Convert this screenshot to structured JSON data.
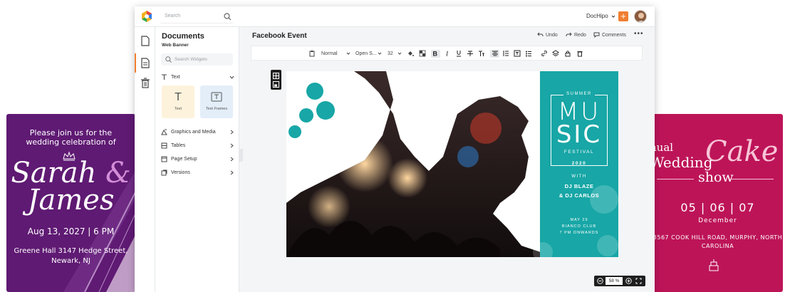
{
  "left_card": {
    "invite": "Please join us for the wedding celebration of",
    "name_one": "Sarah",
    "amp": "&",
    "name_two": "James",
    "date": "Aug 13, 2027 | 6 PM",
    "address": "Greene Hall 3147 Hedge Street, Newark, NJ",
    "color": "#5f1a73"
  },
  "right_card": {
    "annual": "nual",
    "wedding": "Wedding",
    "cake": "Cake",
    "show": "show",
    "date_numbers": "05 | 06 | 07",
    "month": "December",
    "address": "3567 COOK HILL ROAD, MURPHY, NORTH CAROLINA",
    "color": "#bd1458"
  },
  "topbar": {
    "search_placeholder": "Search",
    "account": "DocHipo",
    "plus": "+"
  },
  "panel": {
    "title": "Documents",
    "subtitle": "Web Banner",
    "widget_search_placeholder": "Search Widgets",
    "text_section": "Text",
    "tiles": [
      {
        "glyph": "T",
        "caption": "Text",
        "color": "#fdf3dc"
      },
      {
        "glyph": "⊤",
        "caption": "Text Frames",
        "color": "#e3eef9"
      }
    ],
    "sections": [
      "Graphics and Media",
      "Tables",
      "Page Setup",
      "Versions"
    ]
  },
  "editor": {
    "doc_title": "Facebook Event",
    "undo": "Undo",
    "redo": "Redo",
    "comments": "Comments",
    "more": "•••"
  },
  "toolbar": {
    "style": "Normal",
    "font": "Open S...",
    "size": "32"
  },
  "design": {
    "summer": "SUMMER",
    "mu": "MU",
    "sic": "SIC",
    "festival": "FESTIVAL",
    "year": "2020",
    "with": "WITH",
    "dj_one": "DJ BLAZE",
    "dj_two": "& DJ CARLOS",
    "date": "MAY 29",
    "venue": "BIANCO CLUB",
    "time": "7 PM ONWARDS",
    "accent": "#18a6a6"
  },
  "zoom": {
    "value": "58",
    "unit": "%"
  },
  "colors": {
    "brand_orange": "#f07f32"
  }
}
